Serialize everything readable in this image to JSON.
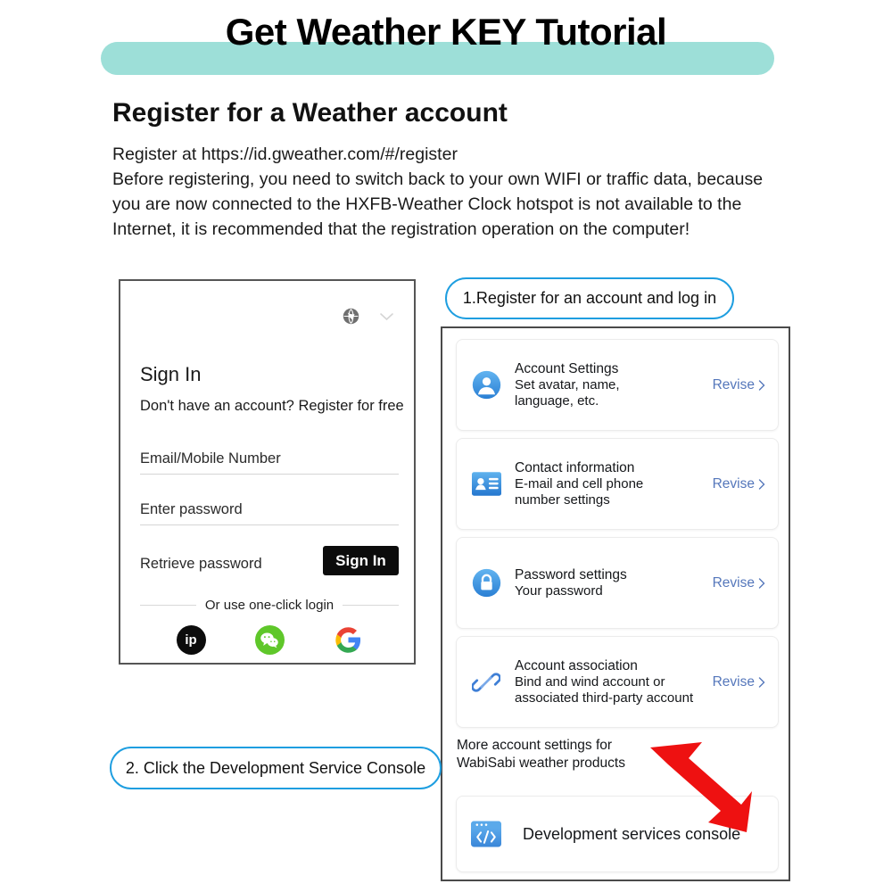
{
  "page": {
    "title": "Get Weather KEY Tutorial",
    "banner_color": "#9ddfd8",
    "section_heading": "Register for a Weather account",
    "intro_lines": [
      "Register at https://id.gweather.com/#/register",
      "Before registering, you need to switch back to your own WIFI or traffic data, because",
      "you are now connected to the HXFB-Weather Clock hotspot is not available to the",
      "Internet, it is recommended that the registration operation on the computer!"
    ]
  },
  "signin_card": {
    "globe_icon": "globe-icon",
    "chevron_icon": "chevron-down-icon",
    "heading": "Sign In",
    "subtext": "Don't have an account? Register for free",
    "email_field": {
      "value": "Email/Mobile Number",
      "placeholder": "Email/Mobile Number"
    },
    "password_field": {
      "value": "Enter password",
      "placeholder": "Enter password"
    },
    "retrieve_password": "Retrieve password",
    "signin_button": "Sign In",
    "divider_label": "Or use one-click login",
    "social": [
      {
        "name": "ip-login-button",
        "label": "ip",
        "color": "#0c0c0c"
      },
      {
        "name": "wechat-login-button",
        "label": "",
        "color": "#5fc72a"
      },
      {
        "name": "google-login-button",
        "label": "",
        "color": "#ffffff"
      }
    ]
  },
  "callouts": {
    "register": "1.Register for an account and log in",
    "console": "2. Click the Development Service Console",
    "border_color": "#1e9ee0"
  },
  "settings_panel": {
    "revise_label": "Revise",
    "accent_link_color": "#5577bb",
    "items": [
      {
        "icon": "avatar-icon",
        "title": "Account Settings",
        "desc_lines": [
          "Set avatar, name,",
          "language, etc."
        ],
        "action": "Revise"
      },
      {
        "icon": "id-card-icon",
        "title": "Contact information",
        "desc_lines": [
          "E-mail and cell phone",
          "number settings"
        ],
        "action": "Revise"
      },
      {
        "icon": "lock-icon",
        "title": "Password settings",
        "desc_lines": [
          "Your password"
        ],
        "action": "Revise"
      },
      {
        "icon": "link-icon",
        "title": "Account association",
        "desc_lines": [
          "Bind and wind account or",
          "associated third-party account"
        ],
        "action": "Revise"
      }
    ],
    "more_note_lines": [
      "More account settings for",
      "WabiSabi weather products"
    ],
    "console_row": {
      "icon": "code-console-icon",
      "label": "Development services console"
    },
    "arrow": {
      "name": "red-arrow-annotation",
      "color": "#ee1111"
    }
  }
}
